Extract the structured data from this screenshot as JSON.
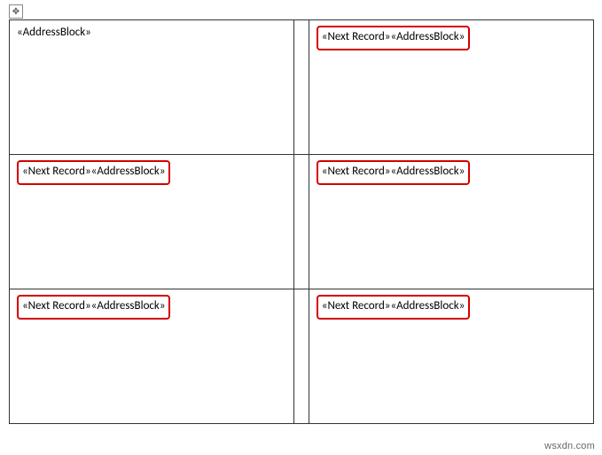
{
  "cells": [
    [
      {
        "text": "«AddressBlock»",
        "highlight": false
      },
      {
        "text": "«Next Record»«AddressBlock»",
        "highlight": true
      }
    ],
    [
      {
        "text": "«Next Record»«AddressBlock»",
        "highlight": true
      },
      {
        "text": "«Next Record»«AddressBlock»",
        "highlight": true
      }
    ],
    [
      {
        "text": "«Next Record»«AddressBlock»",
        "highlight": true
      },
      {
        "text": "«Next Record»«AddressBlock»",
        "highlight": true
      }
    ]
  ],
  "move_handle_glyph": "✥",
  "watermark": "wsxdn.com"
}
